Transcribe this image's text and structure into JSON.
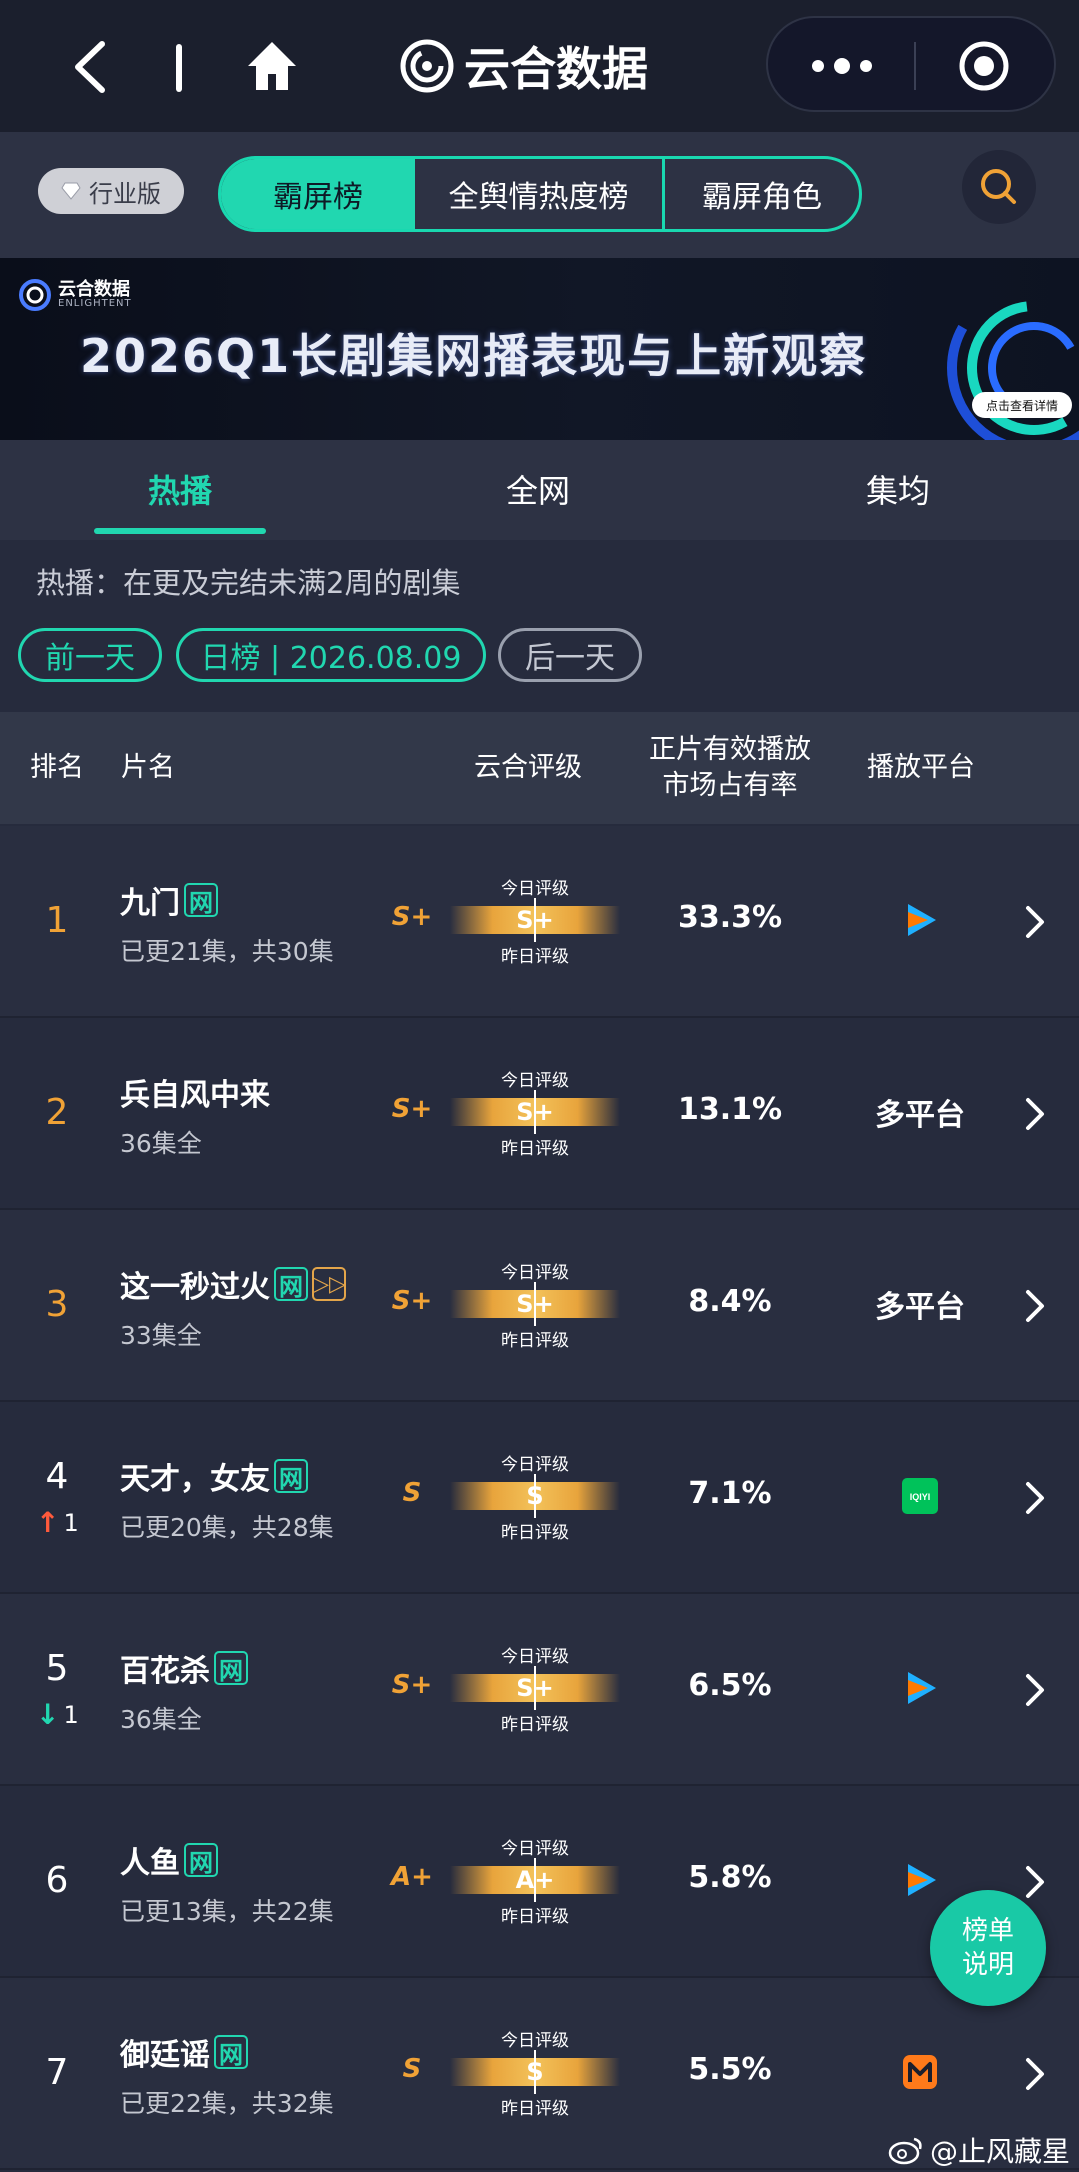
{
  "topbar": {
    "app_title": "云合数据"
  },
  "navrow": {
    "industry_badge": "行业版",
    "segments": [
      "霸屏榜",
      "全舆情热度榜",
      "霸屏角色"
    ]
  },
  "banner": {
    "logo_cn": "云合数据",
    "logo_en": "ENLIGHTENT",
    "title": "2026Q1长剧集网播表现与上新观察",
    "detail_btn": "点击查看详情"
  },
  "tabs": [
    "热播",
    "全网",
    "集均"
  ],
  "info": {
    "description": "热播：在更及完结未满2周的剧集",
    "prev_day": "前一天",
    "date_label": "日榜 | 2026.08.09",
    "next_day": "后一天"
  },
  "table_header": {
    "rank": "排名",
    "title": "片名",
    "rating": "云合评级",
    "share_line1": "正片有效播放",
    "share_line2": "市场占有率",
    "platform": "播放平台"
  },
  "gauge_labels": {
    "today": "今日评级",
    "yesterday": "昨日评级"
  },
  "rows": [
    {
      "rank": "1",
      "title": "九门",
      "net_tag": "网",
      "adv_tag": "",
      "episodes": "已更21集，共30集",
      "grade": "S+",
      "today_grade": "S+",
      "share": "33.3%",
      "platform_text": "",
      "platform_icon": "tencent-video-icon",
      "change": "",
      "change_dir": ""
    },
    {
      "rank": "2",
      "title": "兵自风中来",
      "net_tag": "",
      "adv_tag": "",
      "episodes": "36集全",
      "grade": "S+",
      "today_grade": "S+",
      "share": "13.1%",
      "platform_text": "多平台",
      "platform_icon": "",
      "change": "",
      "change_dir": ""
    },
    {
      "rank": "3",
      "title": "这一秒过火",
      "net_tag": "网",
      "adv_tag": "▷▷",
      "episodes": "33集全",
      "grade": "S+",
      "today_grade": "S+",
      "share": "8.4%",
      "platform_text": "多平台",
      "platform_icon": "",
      "change": "",
      "change_dir": ""
    },
    {
      "rank": "4",
      "title": "天才，女友",
      "net_tag": "网",
      "adv_tag": "",
      "episodes": "已更20集，共28集",
      "grade": "S",
      "today_grade": "S",
      "share": "7.1%",
      "platform_text": "",
      "platform_icon": "iqiyi-icon",
      "change": "1",
      "change_dir": "up"
    },
    {
      "rank": "5",
      "title": "百花杀",
      "net_tag": "网",
      "adv_tag": "",
      "episodes": "36集全",
      "grade": "S+",
      "today_grade": "S+",
      "share": "6.5%",
      "platform_text": "",
      "platform_icon": "tencent-video-icon",
      "change": "1",
      "change_dir": "down"
    },
    {
      "rank": "6",
      "title": "人鱼",
      "net_tag": "网",
      "adv_tag": "",
      "episodes": "已更13集，共22集",
      "grade": "A+",
      "today_grade": "A+",
      "share": "5.8%",
      "platform_text": "",
      "platform_icon": "tencent-video-icon",
      "change": "",
      "change_dir": ""
    },
    {
      "rank": "7",
      "title": "御廷谣",
      "net_tag": "网",
      "adv_tag": "",
      "episodes": "已更22集，共32集",
      "grade": "S",
      "today_grade": "S",
      "share": "5.5%",
      "platform_text": "",
      "platform_icon": "mango-tv-icon",
      "change": "",
      "change_dir": ""
    }
  ],
  "float_button": {
    "line1": "榜单",
    "line2": "说明"
  },
  "watermark_user": "@止风藏星",
  "colors": {
    "accent": "#21d7b0",
    "gold": "#f0a236",
    "rank_orange": "#f0a236",
    "up": "#ff5a3c"
  },
  "iqiyi_label": "iQIYI"
}
